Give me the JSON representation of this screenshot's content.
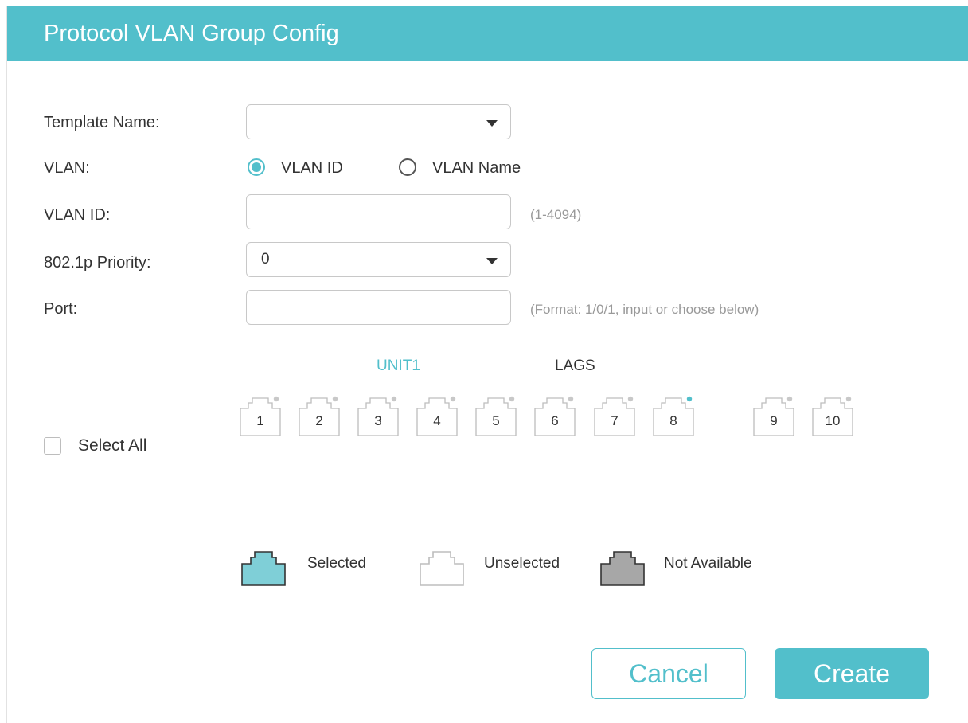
{
  "dialog": {
    "title": "Protocol VLAN Group Config"
  },
  "form": {
    "template_name": {
      "label": "Template Name:",
      "value": ""
    },
    "vlan": {
      "label": "VLAN:",
      "options": [
        {
          "label": "VLAN ID",
          "selected": true
        },
        {
          "label": "VLAN Name",
          "selected": false
        }
      ]
    },
    "vlan_id": {
      "label": "VLAN ID:",
      "value": "",
      "hint": "(1-4094)"
    },
    "priority": {
      "label": "802.1p Priority:",
      "value": "0"
    },
    "port": {
      "label": "Port:",
      "value": "",
      "hint": "(Format: 1/0/1, input or choose below)"
    }
  },
  "port_panel": {
    "unit_label": "UNIT1",
    "lags_label": "LAGS",
    "select_all_label": "Select All",
    "unit_ports": [
      "1",
      "2",
      "3",
      "4",
      "5",
      "6",
      "7",
      "8"
    ],
    "lag_ports": [
      "9",
      "10"
    ],
    "status_dot_colors": {
      "1": "#c8c8c8",
      "2": "#c8c8c8",
      "3": "#c8c8c8",
      "4": "#c8c8c8",
      "5": "#c8c8c8",
      "6": "#c8c8c8",
      "7": "#c8c8c8",
      "8": "#52bfcb",
      "9": "#c8c8c8",
      "10": "#c8c8c8"
    }
  },
  "legend": {
    "selected": "Selected",
    "unselected": "Unselected",
    "not_available": "Not Available"
  },
  "buttons": {
    "cancel": "Cancel",
    "create": "Create"
  },
  "colors": {
    "accent": "#52bfcb",
    "not_available": "#a7a7a7",
    "text": "#333333",
    "hint": "#999999"
  }
}
